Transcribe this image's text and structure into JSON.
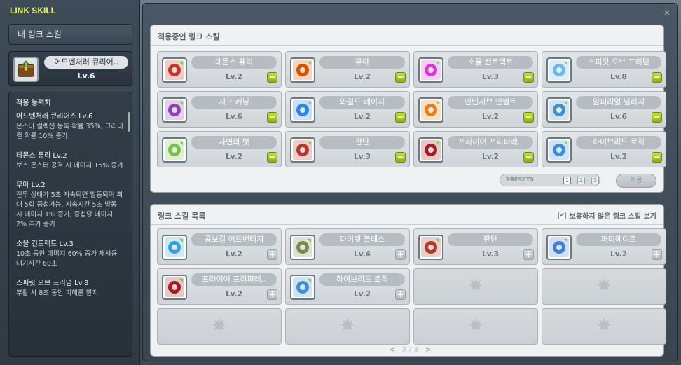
{
  "left": {
    "title": "LINK SKILL",
    "my_link_header": "내 링크 스킬",
    "my_skill": {
      "name": "어드벤처러 큐리어..",
      "level": "Lv.6",
      "icon": "chest-icon"
    },
    "effects_title": "적용 능력치",
    "effects": [
      {
        "name": "어드벤처러 큐리어스 Lv.6",
        "desc": "몬스터 컬렉션 등록 확률 35%, 크리티컬 확률 10% 증가"
      },
      {
        "name": "데몬스 퓨리 Lv.2",
        "desc": "보스 몬스터 공격 시 데미지 15% 증가"
      },
      {
        "name": "무아 Lv.2",
        "desc": "전투 상태가 5초 지속되면 발동되며 최대 5회 중첩가능, 지속시간 5초 발동 시 데미지 1% 증가, 중첩당 데미지 2% 추가 증가"
      },
      {
        "name": "소울 컨트랙트 Lv.3",
        "desc": "10초 동안 데미지 60% 증가 재사용 대기시간 60초"
      },
      {
        "name": "스피릿 오브 프리덤 Lv.8",
        "desc": "부활 시 8초 동안 피해를 받지"
      }
    ]
  },
  "main": {
    "close": "×",
    "active_section": {
      "title": "적용중인 링크 스킬",
      "skills": [
        {
          "name": "데몬스 퓨리",
          "level": "Lv.2",
          "icon": "demon-fury-icon",
          "color": "#c0392b"
        },
        {
          "name": "무아",
          "level": "Lv.2",
          "icon": "mua-icon",
          "color": "#d35400"
        },
        {
          "name": "소울 컨트랙트",
          "level": "Lv.3",
          "icon": "soul-contract-icon",
          "color": "#d63ad3"
        },
        {
          "name": "스피릿 오브 프리덤",
          "level": "Lv.8",
          "icon": "spirit-of-freedom-icon",
          "color": "#6fb7e6"
        },
        {
          "name": "시프 커닝",
          "level": "Lv.6",
          "icon": "thief-cunning-icon",
          "color": "#8e44ad"
        },
        {
          "name": "와일드 레이지",
          "level": "Lv.2",
          "icon": "wild-rage-icon",
          "color": "#2e86de"
        },
        {
          "name": "인텐시브 인썰트",
          "level": "Lv.2",
          "icon": "intensive-insult-icon",
          "color": "#e67e22"
        },
        {
          "name": "임피리얼 널리지",
          "level": "Lv.6",
          "icon": "imperial-knowledge-icon",
          "color": "#4a90c2"
        },
        {
          "name": "자연의 벗",
          "level": "Lv.2",
          "icon": "friend-of-nature-icon",
          "color": "#7cc04b"
        },
        {
          "name": "판단",
          "level": "Lv.3",
          "icon": "judgment-icon",
          "color": "#b03a2e"
        },
        {
          "name": "프라이어 프리퍼레..",
          "level": "Lv.2",
          "icon": "prior-preparation-icon",
          "color": "#a01f24"
        },
        {
          "name": "하이브리드 로직",
          "level": "Lv.2",
          "icon": "hybrid-logic-icon",
          "color": "#3f8fd2"
        }
      ],
      "minus_label": "−",
      "presets_label": "PRESETS",
      "presets": [
        "1",
        "2",
        "3"
      ],
      "active_preset": "1",
      "apply_label": "적용"
    },
    "list_section": {
      "title": "링크 스킬 목록",
      "show_unowned_label": "보유하지 않은 링크 스킬 보기",
      "show_unowned_checked": true,
      "checkmark": "✔",
      "skills": [
        {
          "name": "콤보킬 어드밴티지",
          "level": "Lv.2",
          "icon": "combo-kill-advantage-icon",
          "color": "#3aa0d8"
        },
        {
          "name": "파이렛 블레스",
          "level": "Lv.4",
          "icon": "pirate-blessing-icon",
          "color": "#7a8a4a"
        },
        {
          "name": "판단",
          "level": "Lv.3",
          "icon": "judgment-icon",
          "color": "#b03a2e"
        },
        {
          "name": "퍼미에이트",
          "level": "Lv.2",
          "icon": "permeate-icon",
          "color": "#3f7fd2"
        },
        {
          "name": "프라이어 프리퍼레..",
          "level": "Lv.2",
          "icon": "prior-preparation-icon",
          "color": "#a01f24"
        },
        {
          "name": "하이브리드 로직",
          "level": "Lv.2",
          "icon": "hybrid-logic-icon",
          "color": "#3f8fd2"
        }
      ],
      "plus_label": "+",
      "empty_slots": 6,
      "empty_icon": "maple-leaf-icon",
      "pagination": {
        "prev": "<",
        "current": "3",
        "separator": "/",
        "total": "3",
        "next": ">"
      }
    }
  }
}
